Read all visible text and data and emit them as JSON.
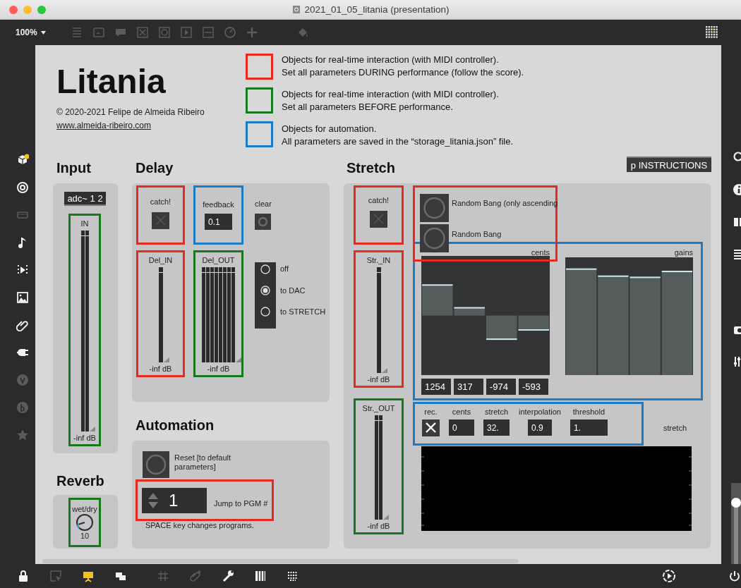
{
  "window": {
    "title": "2021_01_05_litania (presentation)"
  },
  "toolbar": {
    "zoom": "100%"
  },
  "header": {
    "title": "Litania",
    "copyright": "© 2020-2021 Felipe de Almeida Ribeiro",
    "link": "www.almeida-ribeiro.com"
  },
  "legend": [
    {
      "color": "#e62b1e",
      "text": "Objects for real-time interaction (with MIDI controller).\nSet all parameters DURING performance (follow the score)."
    },
    {
      "color": "#17791b",
      "text": "Objects for real-time interaction (with MIDI controller).\nSet all parameters BEFORE performance."
    },
    {
      "color": "#1b7bc4",
      "text": "Objects for automation.\nAll parameters are saved in the “storage_litania.json” file."
    }
  ],
  "instructions_button": "p INSTRUCTIONS",
  "input": {
    "heading": "Input",
    "source": "adc~ 1 2",
    "meter": {
      "color": "#17791b",
      "kind": "stereo",
      "label": "IN",
      "reading": "-inf dB"
    }
  },
  "reverb": {
    "heading": "Reverb",
    "color": "#17791b",
    "label": "wet/dry",
    "value": "10"
  },
  "delay": {
    "heading": "Delay",
    "catch": {
      "color": "#e62b1e",
      "label": "catch!",
      "checked": false
    },
    "feedback": {
      "color": "#1b7bc4",
      "label": "feedback",
      "value": "0.1"
    },
    "clear": {
      "label": "clear"
    },
    "meters": [
      {
        "color": "#e62b1e",
        "kind": "mono",
        "label": "Del_IN",
        "reading": "-inf dB"
      },
      {
        "color": "#17791b",
        "kind": "multichannel",
        "label": "Del_OUT",
        "reading": "-inf dB"
      }
    ],
    "routing": [
      {
        "label": "off",
        "selected": false
      },
      {
        "label": "to DAC",
        "selected": true
      },
      {
        "label": "to STRETCH",
        "selected": false
      }
    ]
  },
  "automation": {
    "heading": "Automation",
    "reset": "Reset [to default parameters]",
    "program": {
      "color": "#e62b1e",
      "value": "1",
      "label": "Jump to PGM #"
    },
    "note": "SPACE key changes programs."
  },
  "stretch": {
    "heading": "Stretch",
    "catch": {
      "color": "#e62b1e",
      "label": "catch!",
      "checked": false
    },
    "meters": [
      {
        "color": "#e62b1e",
        "kind": "mono",
        "label": "Str._IN",
        "reading": "-inf dB"
      },
      {
        "color": "#17791b",
        "kind": "stereo",
        "label": "Str._OUT",
        "reading": "-inf dB"
      }
    ],
    "random": {
      "color": "#e62b1e",
      "buttons": [
        "Random Bang (only ascending",
        "Random Bang"
      ]
    },
    "sliders": {
      "color": "#1b7bc4",
      "cents": {
        "label": "cents",
        "values": [
          "1254",
          "317",
          "-974",
          "-593"
        ]
      },
      "gains": {
        "label": "gains"
      }
    },
    "params": {
      "color": "#1b7bc4",
      "items": [
        {
          "kind": "toggle",
          "label": "rec.",
          "checked": true
        },
        {
          "kind": "number",
          "label": "cents",
          "value": "0"
        },
        {
          "kind": "number",
          "label": "stretch",
          "value": "32."
        },
        {
          "kind": "number",
          "label": "interpolation",
          "value": "0.9"
        },
        {
          "kind": "number",
          "label": "threshold",
          "value": "1."
        }
      ]
    },
    "scope_label": "stretch"
  },
  "output_slider": {
    "level": 0.76
  }
}
